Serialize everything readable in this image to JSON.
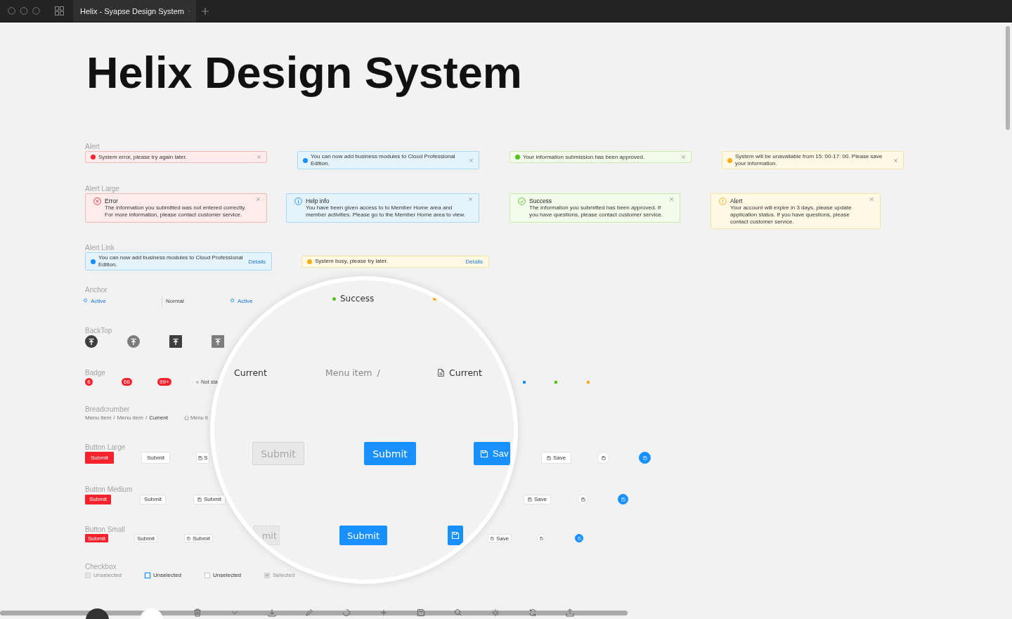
{
  "browser": {
    "tab_title": "Helix - Syapse Design System"
  },
  "title": "Helix Design System",
  "alert": {
    "label": "Alert",
    "items": [
      {
        "kind": "error",
        "text": "System error, please try again later."
      },
      {
        "kind": "info",
        "text": "You can now add business modules to Cloud Professional Edition."
      },
      {
        "kind": "success",
        "text": "Your information submission has been approved."
      },
      {
        "kind": "warning",
        "text": "System will be unavailable from 15: 00-17: 00. Please save your information."
      }
    ]
  },
  "alert_large": {
    "label": "Alert Large",
    "items": [
      {
        "kind": "error",
        "title": "Error",
        "text": "The information you submitted was not entered correctly. For more information, please contact customer service."
      },
      {
        "kind": "info",
        "title": "Help info",
        "text": "You have been given access to to Member Home area and member activities. Please go to the Member Home area to view."
      },
      {
        "kind": "success",
        "title": "Success",
        "text": "The information you submitted has been approved. If you have questions, please contact customer service."
      },
      {
        "kind": "warning",
        "title": "Alert",
        "text": "Your account will expire in 3 days, please update application status. If you have questions, please contact customer service."
      }
    ]
  },
  "alert_link": {
    "label": "Alert Link",
    "items": [
      {
        "kind": "info",
        "text": "You can now add business modules to Cloud Professional Edition.",
        "link": "Details"
      },
      {
        "kind": "warning",
        "text": "System busy, please try later.",
        "link": "Details"
      }
    ]
  },
  "anchor": {
    "label": "Anchor",
    "items": [
      {
        "label": "Active",
        "selected": true
      },
      {
        "label": "Normal",
        "selected": false
      },
      {
        "label": "Active",
        "selected": true
      }
    ]
  },
  "backtop": {
    "label": "BackTop",
    "items": [
      {
        "kind": "round-dark"
      },
      {
        "kind": "round-grey"
      },
      {
        "kind": "square-dark"
      },
      {
        "kind": "square-grey"
      }
    ]
  },
  "badge": {
    "label": "Badge",
    "counts": [
      "6",
      "66",
      "99+"
    ],
    "status": [
      {
        "label": "Not sta",
        "color": "#bfbfbf"
      }
    ],
    "dots": [
      {
        "color": "#1890ff"
      },
      {
        "color": "#52c41a"
      },
      {
        "color": "#faad14"
      }
    ]
  },
  "breadcrumb": {
    "label": "Breadcrumber",
    "separator": "/",
    "trails": [
      {
        "kind": "plain",
        "items": [
          "Menu item",
          "Menu item",
          "Current"
        ]
      },
      {
        "kind": "home",
        "items": [
          "Menu it"
        ]
      }
    ]
  },
  "button_large": {
    "label": "Button Large",
    "items": [
      {
        "kind": "danger",
        "text": "Submit"
      },
      {
        "kind": "default",
        "text": "Submit"
      },
      {
        "kind": "icon-text",
        "text": "S"
      },
      {
        "kind": "icon-text",
        "text": "Save"
      },
      {
        "kind": "icon-circle"
      },
      {
        "kind": "icon-circle-primary"
      }
    ]
  },
  "button_medium": {
    "label": "Button Medium",
    "items": [
      {
        "kind": "danger",
        "text": "Submit"
      },
      {
        "kind": "default",
        "text": "Submit"
      },
      {
        "kind": "icon-text",
        "text": "Submit"
      },
      {
        "kind": "icon-text",
        "text": "Save"
      },
      {
        "kind": "icon-circle"
      },
      {
        "kind": "icon-circle-primary"
      }
    ]
  },
  "button_small": {
    "label": "Button Small",
    "items": [
      {
        "kind": "danger",
        "text": "Submit"
      },
      {
        "kind": "default",
        "text": "Submit"
      },
      {
        "kind": "icon-text",
        "text": "Submit"
      },
      {
        "kind": "icon-text",
        "text": "Save"
      },
      {
        "kind": "icon-circle"
      },
      {
        "kind": "icon-circle-primary"
      }
    ]
  },
  "checkbox": {
    "label": "Checkbox",
    "items": [
      {
        "kind": "plain",
        "label": "Unselected",
        "checked": false,
        "disabled": true
      },
      {
        "kind": "focus",
        "label": "Unselected",
        "checked": false,
        "disabled": false
      },
      {
        "kind": "plain",
        "label": "Unselected",
        "checked": false,
        "disabled": false
      },
      {
        "kind": "plain",
        "label": "Selected",
        "checked": true,
        "disabled": true
      }
    ]
  },
  "magnifier": {
    "status": [
      {
        "label": "Success",
        "color": "#52c41a"
      },
      {
        "color": "#faad14"
      }
    ],
    "breadcrumb": [
      {
        "kind": "current",
        "text": "Current"
      },
      {
        "kind": "link",
        "text": "Menu item",
        "separator": "/"
      },
      {
        "kind": "doc",
        "text": "Current"
      }
    ],
    "buttons": [
      {
        "kind": "disabled",
        "text": "Submit"
      },
      {
        "kind": "primary",
        "text": "Submit"
      },
      {
        "kind": "primary-icon",
        "text": "Sav"
      }
    ],
    "small_buttons": [
      {
        "kind": "disabled",
        "text": "mit"
      },
      {
        "kind": "primary",
        "text": "Submit"
      },
      {
        "kind": "primary-icon"
      }
    ]
  }
}
